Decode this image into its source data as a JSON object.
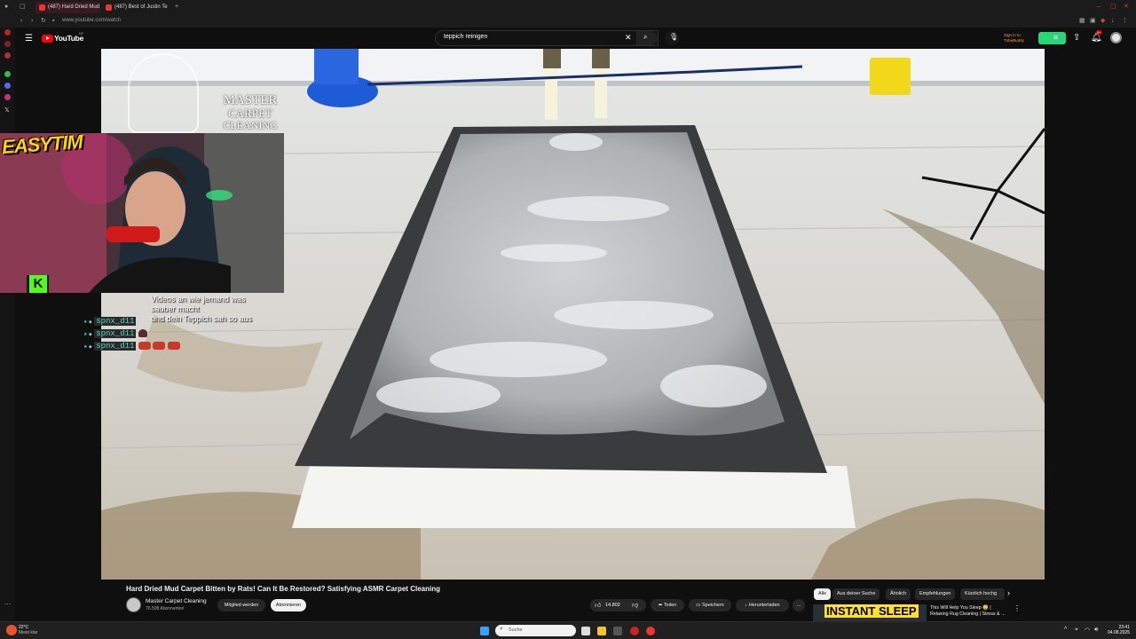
{
  "browser": {
    "tabs": [
      {
        "title": "(487) Hard Dried Mud"
      },
      {
        "title": "(487) Best of Justin Te"
      }
    ],
    "url": "www.youtube.com/watch",
    "new_tab_symbol": "+"
  },
  "youtube": {
    "logo_text": "YouTube",
    "logo_superscript": "DE",
    "search_query": "teppich reinigen",
    "signin_line1": "Sign in to",
    "signin_line2": "TubeBuddy",
    "notification_count": "9+"
  },
  "video": {
    "watermark_line1": "MASTER",
    "watermark_line2": "CARPET",
    "watermark_line3": "CLEANING",
    "streamer_logo": "EASYTIM"
  },
  "chat": {
    "caption_lines": [
      "Videos an wie jemand was",
      "sauber macht",
      "und dein Teppich sah so aus"
    ],
    "messages": [
      {
        "user": "spnx_d11",
        "text": ""
      },
      {
        "user": "spnx_d11",
        "text": ""
      },
      {
        "user": "spnx_d11",
        "text": ""
      }
    ]
  },
  "meta": {
    "title": "Hard Dried Mud Carpet Bitten by Rats! Can It Be Restored? Satisfying ASMR Carpet Cleaning",
    "channel": "Master Carpet Cleaning",
    "subscribers": "76.508 Abonnenten",
    "join_label": "Mitglied werden",
    "subscribe_label": "Abonnieren",
    "likes": "14.802",
    "share_label": "Teilen",
    "save_label": "Speichern",
    "download_label": "Herunterladen",
    "more_label": "..."
  },
  "chips": [
    "Alle",
    "Aus deiner Suche",
    "Ähnlich",
    "Empfehlungen",
    "Kürzlich hochg"
  ],
  "recommendation": {
    "thumb_text": "INSTANT SLEEP",
    "title_line1": "This Will Help You Sleep 😴 |",
    "title_line2": "Relaxing Rug Cleaning | Stress & ..."
  },
  "taskbar": {
    "weather_temp": "22°C",
    "weather_desc": "Meist klar",
    "search_placeholder": "Suche",
    "time": "23:41",
    "date": "04.08.2025"
  },
  "colors": {
    "yt_red": "#ff0000",
    "tubebuddy_green": "#2bd47a",
    "chat_user": "#56d8c2"
  }
}
